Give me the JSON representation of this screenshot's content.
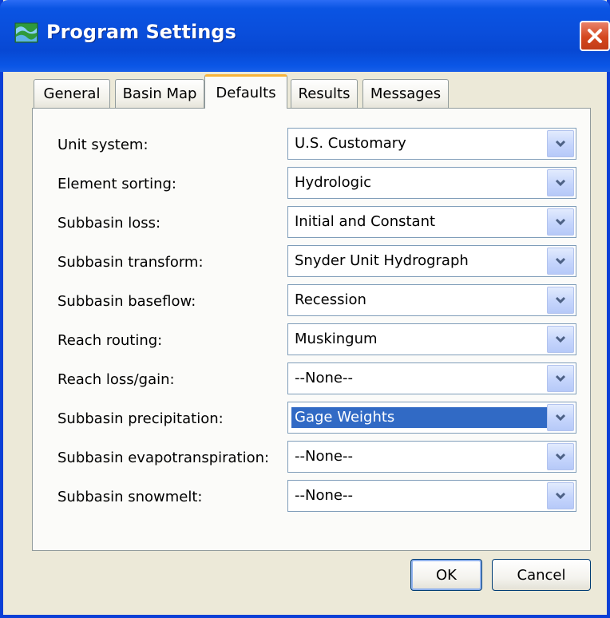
{
  "window": {
    "title": "Program Settings"
  },
  "tabs": [
    {
      "label": "General"
    },
    {
      "label": "Basin Map"
    },
    {
      "label": "Defaults",
      "active": true
    },
    {
      "label": "Results"
    },
    {
      "label": "Messages"
    }
  ],
  "defaults": [
    {
      "label": "Unit system:",
      "value": "U.S. Customary"
    },
    {
      "label": "Element sorting:",
      "value": "Hydrologic"
    },
    {
      "label": "Subbasin loss:",
      "value": "Initial and Constant"
    },
    {
      "label": "Subbasin transform:",
      "value": "Snyder Unit Hydrograph"
    },
    {
      "label": "Subbasin baseflow:",
      "value": "Recession"
    },
    {
      "label": "Reach routing:",
      "value": "Muskingum"
    },
    {
      "label": "Reach loss/gain:",
      "value": "--None--"
    },
    {
      "label": "Subbasin precipitation:",
      "value": "Gage Weights",
      "selected": true
    },
    {
      "label": "Subbasin evapotranspiration:",
      "value": "--None--"
    },
    {
      "label": "Subbasin snowmelt:",
      "value": "--None--"
    }
  ],
  "buttons": {
    "ok": "OK",
    "cancel": "Cancel"
  },
  "icons": {
    "app": "app-icon",
    "close": "close-icon",
    "dropdown": "chevron-down-icon"
  },
  "colors": {
    "title_bar": "#0a4edb",
    "dialog_bg": "#ece9d8",
    "close_button": "#d4471e",
    "active_tab_highlight": "#f8b43a",
    "selection": "#316ac5"
  }
}
